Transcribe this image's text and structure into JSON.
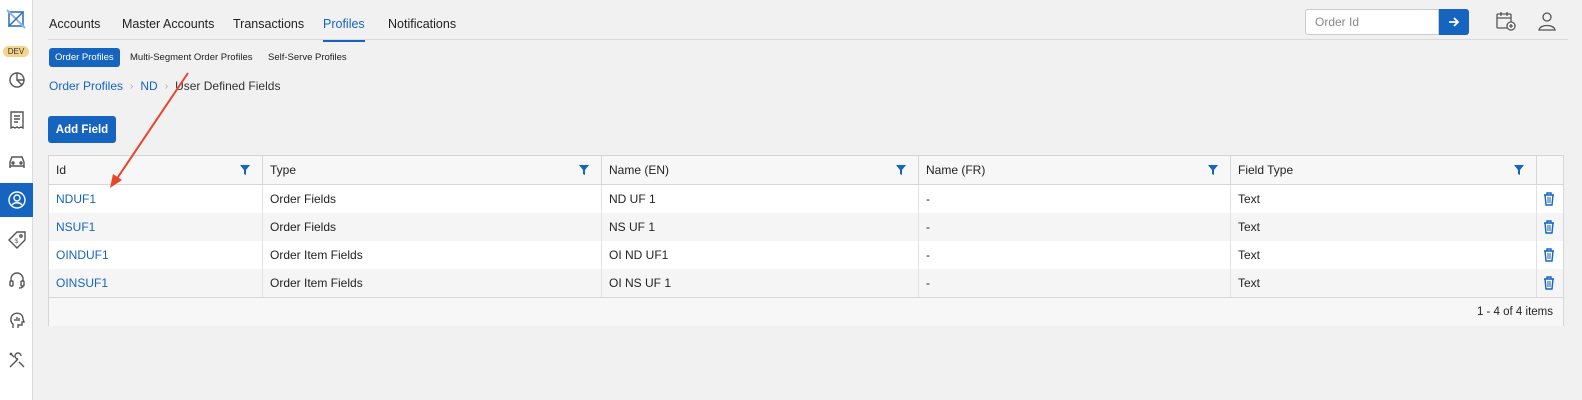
{
  "env_badge": "DEV",
  "nav": {
    "tabs": [
      {
        "label": "Accounts"
      },
      {
        "label": "Master Accounts"
      },
      {
        "label": "Transactions"
      },
      {
        "label": "Profiles",
        "active": true
      },
      {
        "label": "Notifications"
      }
    ],
    "search_placeholder": "Order Id"
  },
  "subtabs": [
    {
      "label": "Order Profiles",
      "active": true
    },
    {
      "label": "Multi-Segment Order Profiles"
    },
    {
      "label": "Self-Serve Profiles"
    }
  ],
  "breadcrumb": {
    "items": [
      "Order Profiles",
      "ND"
    ],
    "current": "User Defined Fields"
  },
  "add_button": "Add Field",
  "table": {
    "columns": [
      "Id",
      "Type",
      "Name (EN)",
      "Name (FR)",
      "Field Type"
    ],
    "rows": [
      {
        "id": "NDUF1",
        "type": "Order Fields",
        "name_en": "ND UF 1",
        "name_fr": "-",
        "field_type": "Text"
      },
      {
        "id": "NSUF1",
        "type": "Order Fields",
        "name_en": "NS UF 1",
        "name_fr": "-",
        "field_type": "Text"
      },
      {
        "id": "OINDUF1",
        "type": "Order Item Fields",
        "name_en": "OI ND UF1",
        "name_fr": "-",
        "field_type": "Text"
      },
      {
        "id": "OINSUF1",
        "type": "Order Item Fields",
        "name_en": "OI NS UF 1",
        "name_fr": "-",
        "field_type": "Text"
      }
    ],
    "pager": "1 - 4 of 4 items"
  },
  "colors": {
    "accent": "#1565c0",
    "annotation_arrow": "#e8452c"
  }
}
